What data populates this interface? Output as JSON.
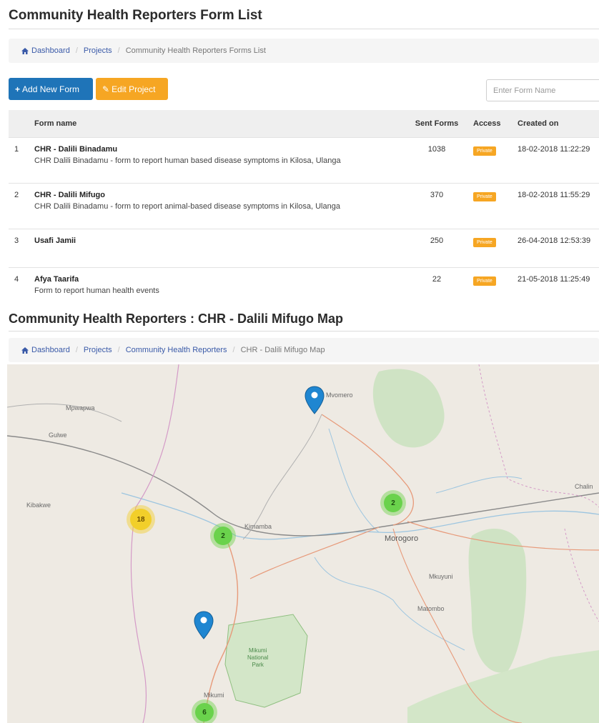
{
  "form_list": {
    "title": "Community Health Reporters Form List",
    "breadcrumb": [
      "Dashboard",
      "Projects",
      "Community Health Reporters Forms List"
    ],
    "add_button": "Add New Form",
    "edit_button": "Edit Project",
    "search_placeholder": "Enter Form Name",
    "columns": [
      "Form name",
      "Sent Forms",
      "Access",
      "Created on"
    ],
    "rows": [
      {
        "num": "1",
        "name": "CHR - Dalili Binadamu",
        "desc": "CHR Dalili Binadamu - form to report human based disease symptoms in Kilosa, Ulanga",
        "sent": "1038",
        "access": "Private",
        "created": "18-02-2018 11:22:29"
      },
      {
        "num": "2",
        "name": "CHR - Dalili Mifugo",
        "desc": "CHR Dalili Binadamu - form to report animal-based disease symptoms in Kilosa, Ulanga",
        "sent": "370",
        "access": "Private",
        "created": "18-02-2018 11:55:29"
      },
      {
        "num": "3",
        "name": "Usafi Jamii",
        "desc": "",
        "sent": "250",
        "access": "Private",
        "created": "26-04-2018 12:53:39"
      },
      {
        "num": "4",
        "name": "Afya Taarifa",
        "desc": "Form to report human health events",
        "sent": "22",
        "access": "Private",
        "created": "21-05-2018 11:25:49"
      }
    ]
  },
  "map_page": {
    "title": "Community Health Reporters : CHR - Dalili Mifugo Map",
    "breadcrumb": [
      "Dashboard",
      "Projects",
      "Community Health Reporters",
      "CHR - Dalili Mifugo Map"
    ],
    "places": {
      "mpwapwa": "Mpwapwa",
      "gulwe": "Gulwe",
      "kibakwe": "Kibakwe",
      "kimamba": "Kimamba",
      "mvomero": "Mvomero",
      "morogoro": "Morogoro",
      "mkuyuni": "Mkuyuni",
      "matombo": "Matombo",
      "mikumi": "Mikumi",
      "chalinze": "Chalin",
      "park_line1": "Mikumi",
      "park_line2": "National",
      "park_line3": "Park"
    },
    "clusters": {
      "yellow": "18",
      "green_kimamba": "2",
      "green_morogoro": "2",
      "green_mikumi": "6"
    }
  },
  "colors": {
    "primary": "#1f74b8",
    "warning": "#f6a623",
    "marker": "#1f86d1",
    "cluster_green": "#6ad24c",
    "cluster_yellow": "#f2cf2a"
  }
}
